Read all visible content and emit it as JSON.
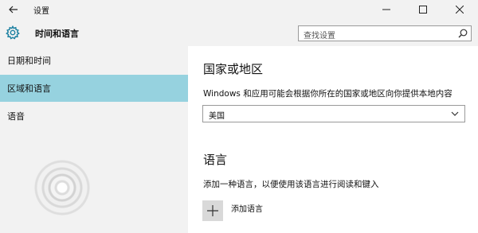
{
  "window": {
    "title": "设置"
  },
  "header": {
    "title": "时间和语言"
  },
  "search": {
    "placeholder": "查找设置"
  },
  "sidebar": {
    "items": [
      {
        "label": "日期和时间",
        "active": false
      },
      {
        "label": "区域和语言",
        "active": true
      },
      {
        "label": "语音",
        "active": false
      }
    ]
  },
  "region": {
    "title": "国家或地区",
    "description": "Windows 和应用可能会根据你所在的国家或地区向你提供本地内容",
    "selected": "美国"
  },
  "language": {
    "title": "语言",
    "description": "添加一种语言，以便使用该语言进行阅读和键入",
    "add_label": "添加语言"
  },
  "colors": {
    "accent": "#96d2df",
    "panel": "#f2f2f2"
  },
  "icons": [
    "back-arrow-icon",
    "minimize-icon",
    "maximize-icon",
    "close-icon",
    "gear-icon",
    "search-icon",
    "chevron-down-icon",
    "plus-icon"
  ]
}
